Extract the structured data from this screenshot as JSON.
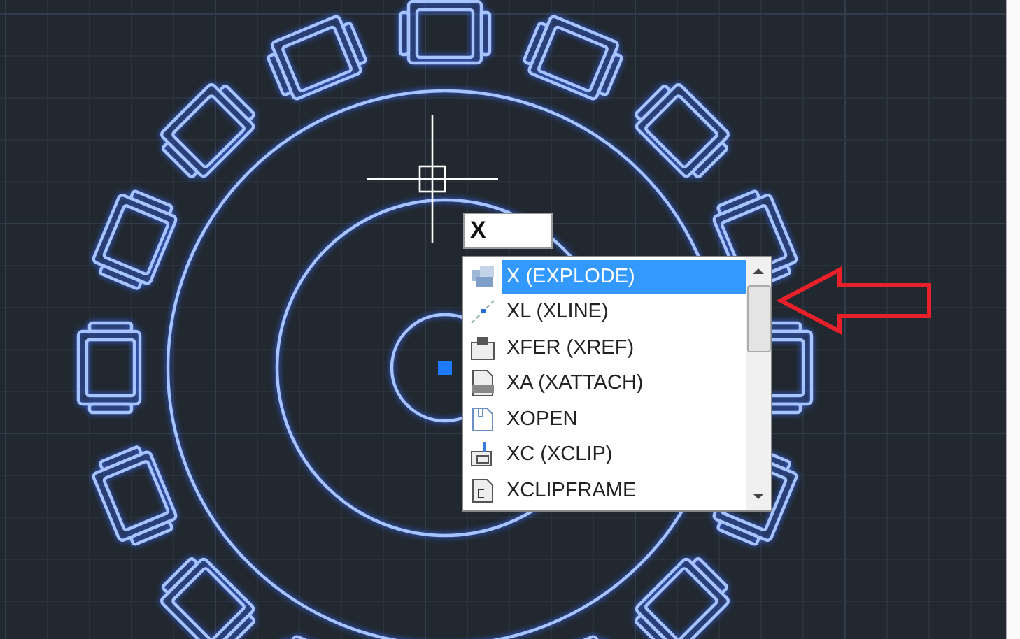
{
  "command_input": {
    "value": "X"
  },
  "suggestions": [
    {
      "label": "X (EXPLODE)",
      "kind": "explode",
      "selected": true
    },
    {
      "label": "XL (XLINE)",
      "kind": "xline",
      "selected": false
    },
    {
      "label": "XFER (XREF)",
      "kind": "xref",
      "selected": false
    },
    {
      "label": "XA (XATTACH)",
      "kind": "xattach",
      "selected": false
    },
    {
      "label": "XOPEN",
      "kind": "xopen",
      "selected": false
    },
    {
      "label": "XC (XCLIP)",
      "kind": "xclip",
      "selected": false
    },
    {
      "label": "XCLIPFRAME",
      "kind": "xclipframe",
      "selected": false
    }
  ]
}
